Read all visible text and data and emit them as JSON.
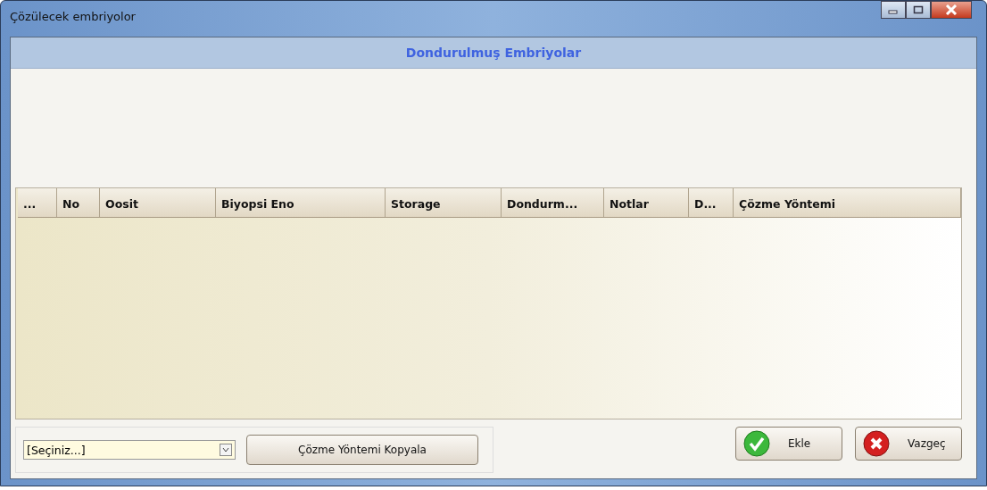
{
  "window": {
    "title": "Çözülecek embriyolor"
  },
  "header": {
    "title": "Dondurulmuş Embriyolar"
  },
  "table": {
    "columns": [
      "...",
      "No",
      "Oosit",
      "Biyopsi Eno",
      "Storage",
      "Dondurm...",
      "Notlar",
      "D...",
      "Çözme Yöntemi"
    ]
  },
  "footer": {
    "dropdown": {
      "value": "[Seçiniz...]"
    },
    "copy_button": "Çözme Yöntemi Kopyala",
    "buttons": [
      {
        "kind": "ok",
        "label": "Ekle"
      },
      {
        "kind": "cancel",
        "label": "Vazgeç"
      }
    ]
  }
}
